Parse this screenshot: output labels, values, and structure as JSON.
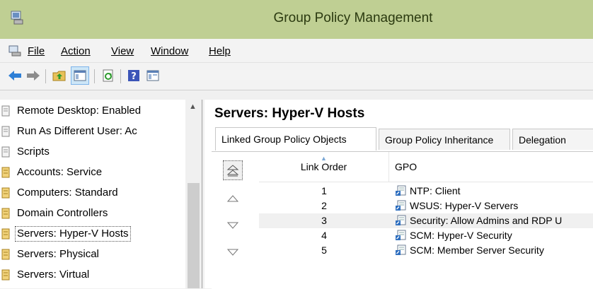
{
  "window": {
    "title": "Group Policy Management"
  },
  "menu": {
    "items": [
      {
        "label": "File"
      },
      {
        "label": "Action"
      },
      {
        "label": "View"
      },
      {
        "label": "Window"
      },
      {
        "label": "Help"
      }
    ]
  },
  "toolbar": {
    "icons": [
      "back-icon",
      "forward-icon",
      "up-folder-icon",
      "show-hide-tree-icon",
      "refresh-icon",
      "help-icon",
      "properties-icon"
    ]
  },
  "tree": {
    "items": [
      {
        "label": "Remote Desktop: Enabled"
      },
      {
        "label": "Run As Different User: Ac"
      },
      {
        "label": "Scripts"
      },
      {
        "label": "Accounts: Service"
      },
      {
        "label": "Computers: Standard"
      },
      {
        "label": "Domain Controllers"
      },
      {
        "label": "Servers: Hyper-V Hosts"
      },
      {
        "label": "Servers: Physical"
      },
      {
        "label": "Servers: Virtual"
      }
    ],
    "selected_index": 6
  },
  "details": {
    "title": "Servers: Hyper-V Hosts",
    "tabs": [
      {
        "label": "Linked Group Policy Objects"
      },
      {
        "label": "Group Policy Inheritance"
      },
      {
        "label": "Delegation"
      }
    ],
    "columns": {
      "link_order": "Link Order",
      "gpo": "GPO"
    },
    "rows": [
      {
        "order": "1",
        "gpo": "NTP: Client"
      },
      {
        "order": "2",
        "gpo": "WSUS: Hyper-V Servers"
      },
      {
        "order": "3",
        "gpo": "Security: Allow Admins and RDP U"
      },
      {
        "order": "4",
        "gpo": "SCM: Hyper-V Security"
      },
      {
        "order": "5",
        "gpo": "SCM: Member Server Security"
      }
    ],
    "selected_row": 2
  },
  "colors": {
    "titlebar": "#bfcf93",
    "selection": "#f0f0f0",
    "accent": "#7eb4ea"
  }
}
